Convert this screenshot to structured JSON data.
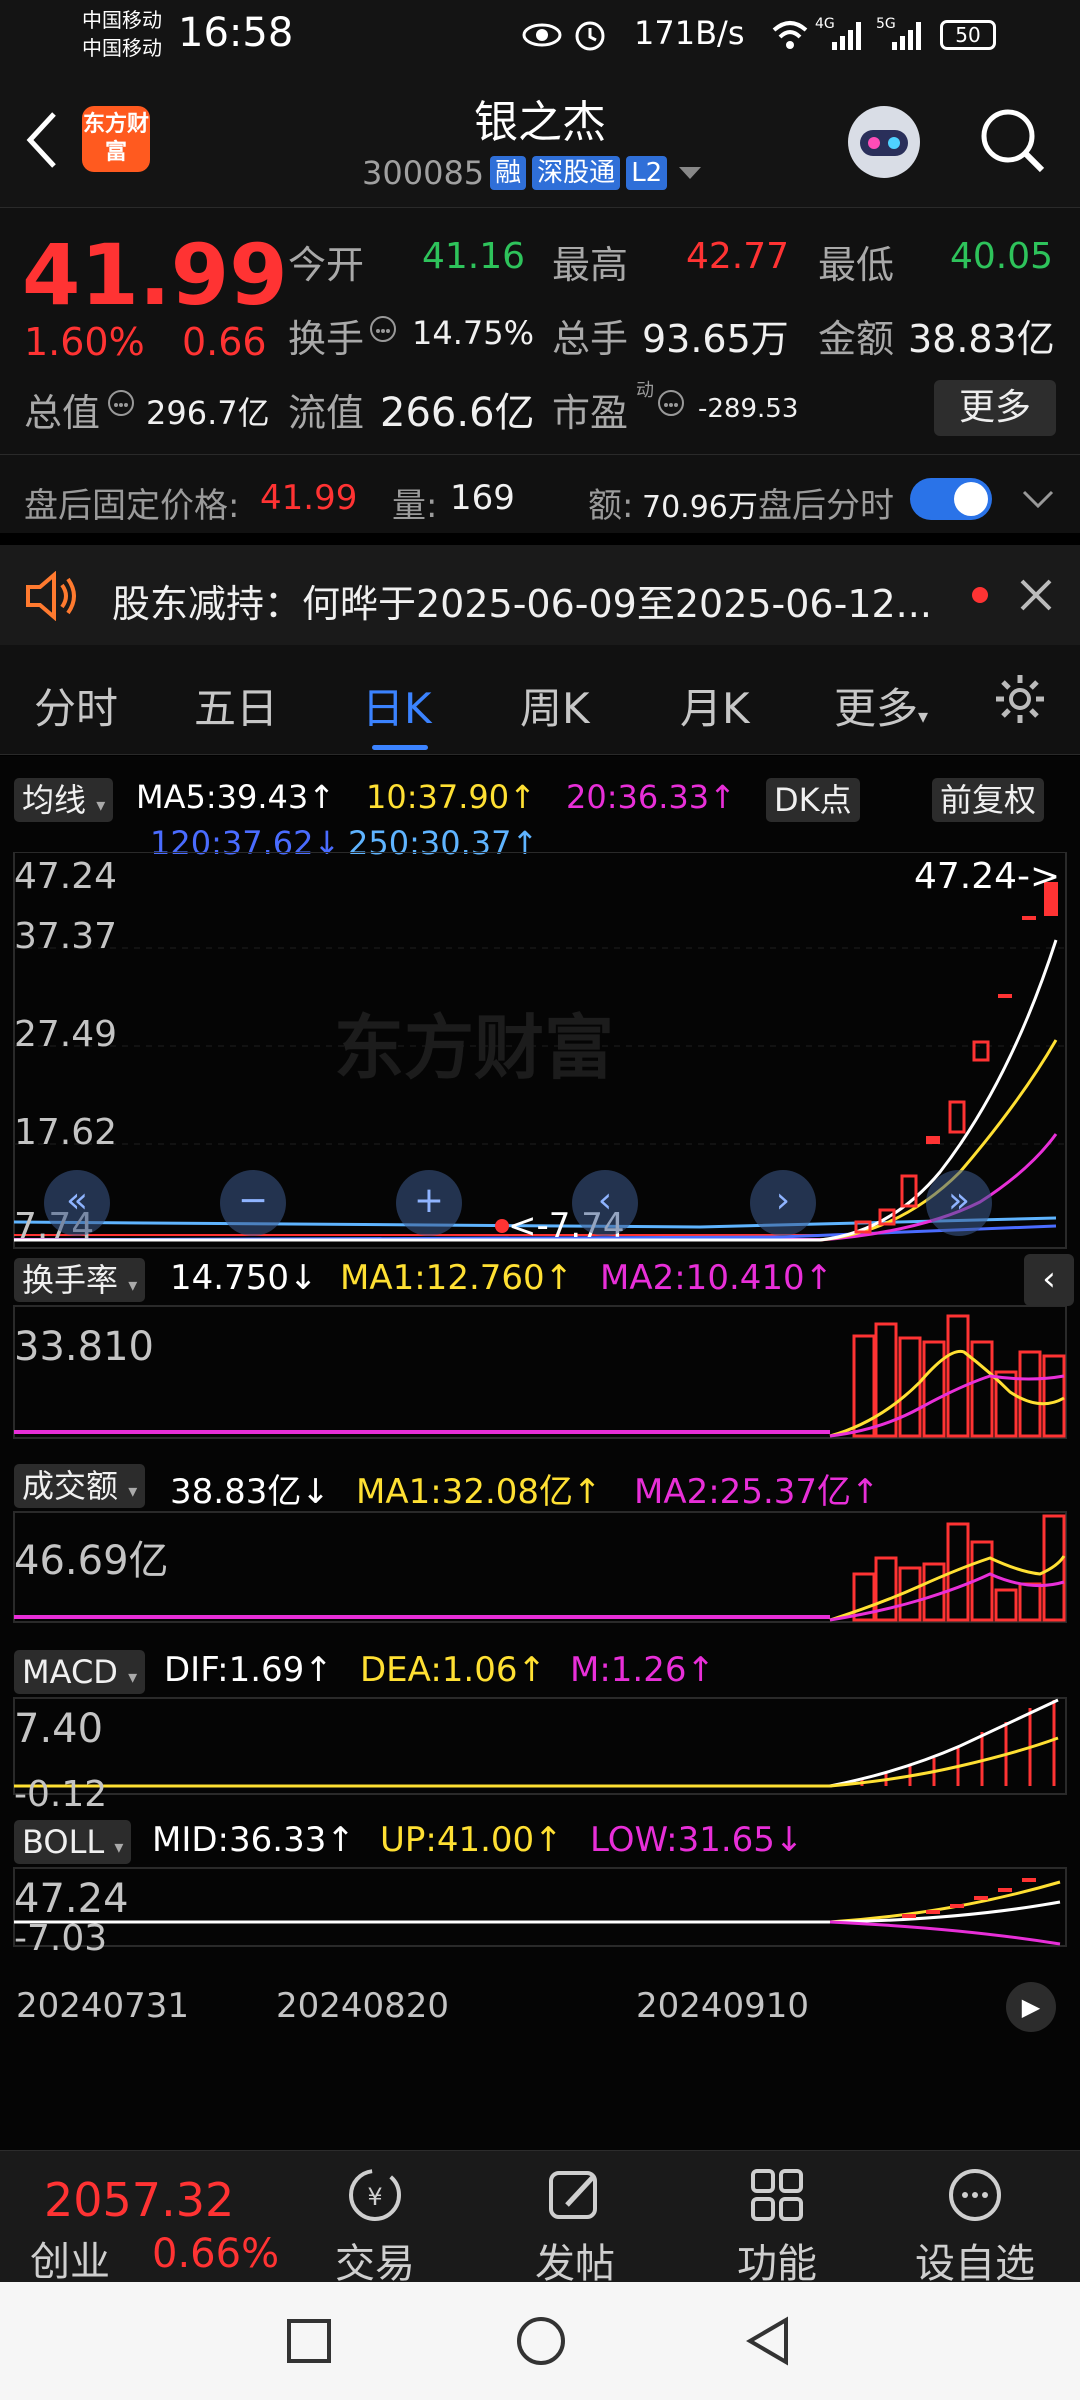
{
  "status_bar": {
    "carrier1": "中国移动",
    "carrier2": "中国移动",
    "time": "16:58",
    "net_speed": "171B/s",
    "signal1": "4G",
    "signal2": "5G",
    "battery": "50"
  },
  "header": {
    "logo_text": "东方财富",
    "title": "银之杰",
    "code": "300085",
    "tags": [
      "融",
      "深股通",
      "L2"
    ]
  },
  "quote": {
    "price": "41.99",
    "change_pct": "1.60%",
    "change": "0.66",
    "open_label": "今开",
    "open": "41.16",
    "high_label": "最高",
    "high": "42.77",
    "low_label": "最低",
    "low": "40.05",
    "turnover_label": "换手",
    "turnover": "14.75%",
    "volume_label": "总手",
    "volume": "93.65万",
    "amount_label": "金额",
    "amount": "38.83亿",
    "mktcap_label": "总值",
    "mktcap": "296.7亿",
    "float_label": "流值",
    "float": "266.6亿",
    "pe_label": "市盈",
    "pe_sup": "动",
    "pe": "-289.53",
    "more_label": "更多"
  },
  "after_hours": {
    "price_label": "盘后固定价格:",
    "price": "41.99",
    "qty_label": "量:",
    "qty": "169",
    "amt_label": "额:",
    "amt": "70.96万",
    "toggle_label": "盘后分时"
  },
  "notice": {
    "text": "股东减持：何晔于2025-06-09至2025-06-12..."
  },
  "tabs": [
    "分时",
    "五日",
    "日K",
    "周K",
    "月K",
    "更多"
  ],
  "active_tab": 2,
  "ma_bar": {
    "chip": "均线",
    "ma5": "MA5:39.43↑",
    "ma10": "10:37.90↑",
    "ma20": "20:36.33↑",
    "ma120": "120:37.62↓",
    "ma250": "250:30.37↑",
    "dk_chip": "DK点",
    "adj_chip": "前复权"
  },
  "kline": {
    "y_labels": [
      "47.24",
      "37.37",
      "27.49",
      "17.62",
      "7.74"
    ],
    "max_marker": "47.24->",
    "min_marker": "<-7.74",
    "watermark": "东方财富"
  },
  "turnover_panel": {
    "chip": "换手率",
    "value": "14.750↓",
    "ma1": "MA1:12.760↑",
    "ma2": "MA2:10.410↑",
    "axis": "33.810"
  },
  "amount_panel": {
    "chip": "成交额",
    "value": "38.83亿↓",
    "ma1": "MA1:32.08亿↑",
    "ma2": "MA2:25.37亿↑",
    "axis": "46.69亿"
  },
  "macd_panel": {
    "chip": "MACD",
    "dif": "DIF:1.69↑",
    "dea": "DEA:1.06↑",
    "m": "M:1.26↑",
    "axis_top": "7.40",
    "axis_bottom": "-0.12"
  },
  "boll_panel": {
    "chip": "BOLL",
    "mid": "MID:36.33↑",
    "up": "UP:41.00↑",
    "low": "LOW:31.65↓",
    "axis_top": "47.24",
    "axis_bottom": "-7.03"
  },
  "x_dates": [
    "20240731",
    "20240820",
    "20240910"
  ],
  "bottom_bar": {
    "index_value": "2057.32",
    "index_name": "创业",
    "index_change": "0.66%",
    "items": [
      "交易",
      "发帖",
      "功能",
      "设自选"
    ]
  },
  "colors": {
    "up": "#ff3333",
    "down": "#2ec35b",
    "accent": "#3b83ff",
    "ma5": "#ffffff",
    "ma10": "#ffe033",
    "ma20": "#e82fd8",
    "ma120": "#4a6cff",
    "ma250": "#5fb4ff"
  }
}
